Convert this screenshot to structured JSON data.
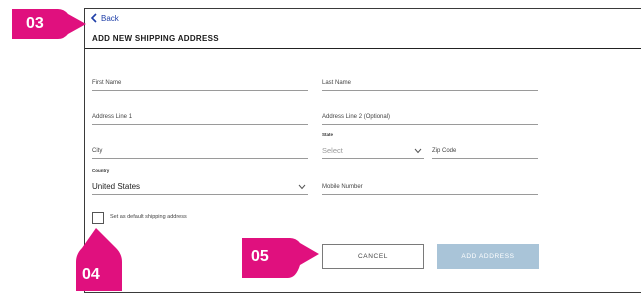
{
  "back_label": "Back",
  "title": "ADD NEW SHIPPING ADDRESS",
  "fields": {
    "first_name": "First Name",
    "last_name": "Last Name",
    "address1": "Address Line 1",
    "address2": "Address Line 2 (Optional)",
    "city": "City",
    "state_label": "State",
    "state_placeholder": "Select",
    "zip": "Zip Code",
    "country_label": "Country",
    "country_value": "United States",
    "mobile": "Mobile Number"
  },
  "checkbox_label": "Set as default shipping address",
  "buttons": {
    "cancel": "CANCEL",
    "add": "ADD ADDRESS"
  },
  "callouts": [
    "03",
    "04",
    "05"
  ],
  "colors": {
    "callout": "#e0107e",
    "add_button": "#a9c4d8",
    "back_link": "#1f3fa8"
  },
  "icons": [
    "chevron-left-icon",
    "chevron-down-icon"
  ]
}
